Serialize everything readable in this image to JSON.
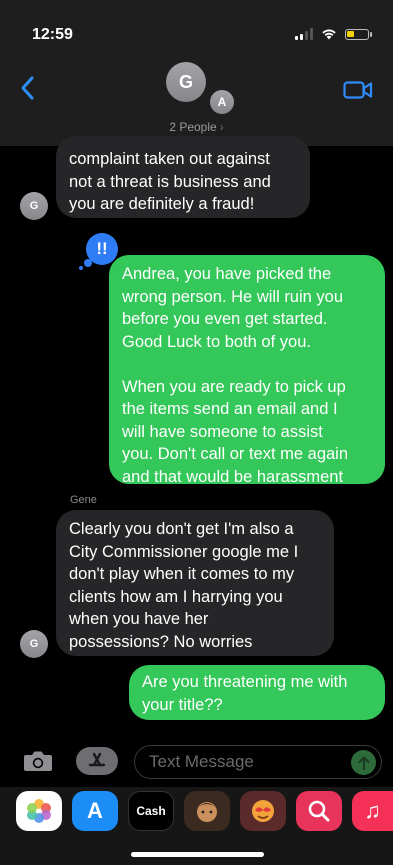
{
  "status_bar": {
    "time": "12:59"
  },
  "header": {
    "avatar_primary": "G",
    "avatar_secondary": "A",
    "participants_label": "2 People",
    "chevron": "›"
  },
  "messages": [
    {
      "direction": "incoming",
      "avatar": "G",
      "text": "complaint taken out against\nnot a threat is business and\nyou are definitely a fraud!"
    },
    {
      "direction": "outgoing",
      "reaction": "!!",
      "text": "Andrea, you have picked the\nwrong person. He will ruin you\nbefore you even get started.\nGood Luck to both of you.\n\nWhen you are ready to pick up\nthe items send an email and I\nwill have someone to assist\nyou. Don't call or text me again\nand that would be harassment"
    },
    {
      "direction": "incoming",
      "sender": "Gene",
      "avatar": "G",
      "text": "Clearly you don't get I'm also a\nCity Commissioner google me I\ndon't play when it comes to my\nclients how am I harrying you\nwhen you have her\npossessions? No worries"
    },
    {
      "direction": "outgoing",
      "text": "Are you threatening me with\nyour title??"
    }
  ],
  "composer": {
    "placeholder": "Text Message"
  },
  "app_tray": [
    {
      "name": "photos-app-icon",
      "label": ""
    },
    {
      "name": "app-store-icon",
      "label": "A"
    },
    {
      "name": "apple-cash-icon",
      "label": "Cash"
    },
    {
      "name": "memoji-icon",
      "label": ""
    },
    {
      "name": "animoji-icon",
      "label": ""
    },
    {
      "name": "web-images-search-icon",
      "label": ""
    },
    {
      "name": "music-icon",
      "label": "♫"
    }
  ],
  "colors": {
    "imessage_blue": "#2e7cf6",
    "sms_green": "#34c759",
    "incoming_bubble": "#262629"
  }
}
